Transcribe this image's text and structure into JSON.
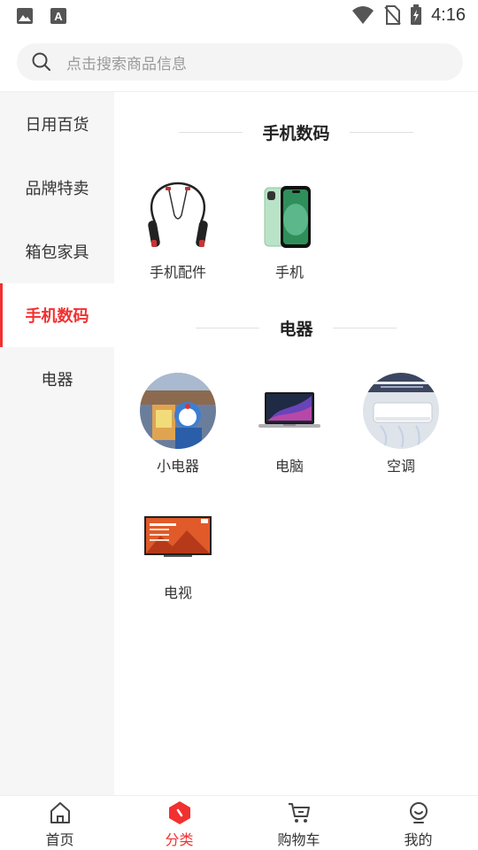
{
  "status_bar": {
    "time": "4:16",
    "icons": [
      "image-icon",
      "keyboard-a-icon",
      "wifi-icon",
      "no-sim-icon",
      "battery-charging-icon"
    ]
  },
  "search": {
    "placeholder": "点击搜索商品信息",
    "icon": "search-icon"
  },
  "sidebar": {
    "items": [
      {
        "label": "日用百货",
        "active": false
      },
      {
        "label": "品牌特卖",
        "active": false
      },
      {
        "label": "箱包家具",
        "active": false
      },
      {
        "label": "手机数码",
        "active": true
      },
      {
        "label": "电器",
        "active": false
      }
    ]
  },
  "sections": [
    {
      "title": "手机数码",
      "items": [
        {
          "label": "手机配件",
          "image": "neckband-earphones"
        },
        {
          "label": "手机",
          "image": "green-smartphone"
        }
      ]
    },
    {
      "title": "电器",
      "items": [
        {
          "label": "小电器",
          "image": "doll-photo"
        },
        {
          "label": "电脑",
          "image": "laptop"
        },
        {
          "label": "空调",
          "image": "air-conditioner"
        },
        {
          "label": "电视",
          "image": "television"
        }
      ]
    }
  ],
  "tabbar": {
    "items": [
      {
        "label": "首页",
        "icon": "home-icon",
        "active": false
      },
      {
        "label": "分类",
        "icon": "category-icon",
        "active": true
      },
      {
        "label": "购物车",
        "icon": "cart-icon",
        "active": false
      },
      {
        "label": "我的",
        "icon": "profile-icon",
        "active": false
      }
    ]
  },
  "colors": {
    "accent": "#f23030",
    "sidebar_bg": "#f6f6f6",
    "search_bg": "#f4f4f4"
  }
}
